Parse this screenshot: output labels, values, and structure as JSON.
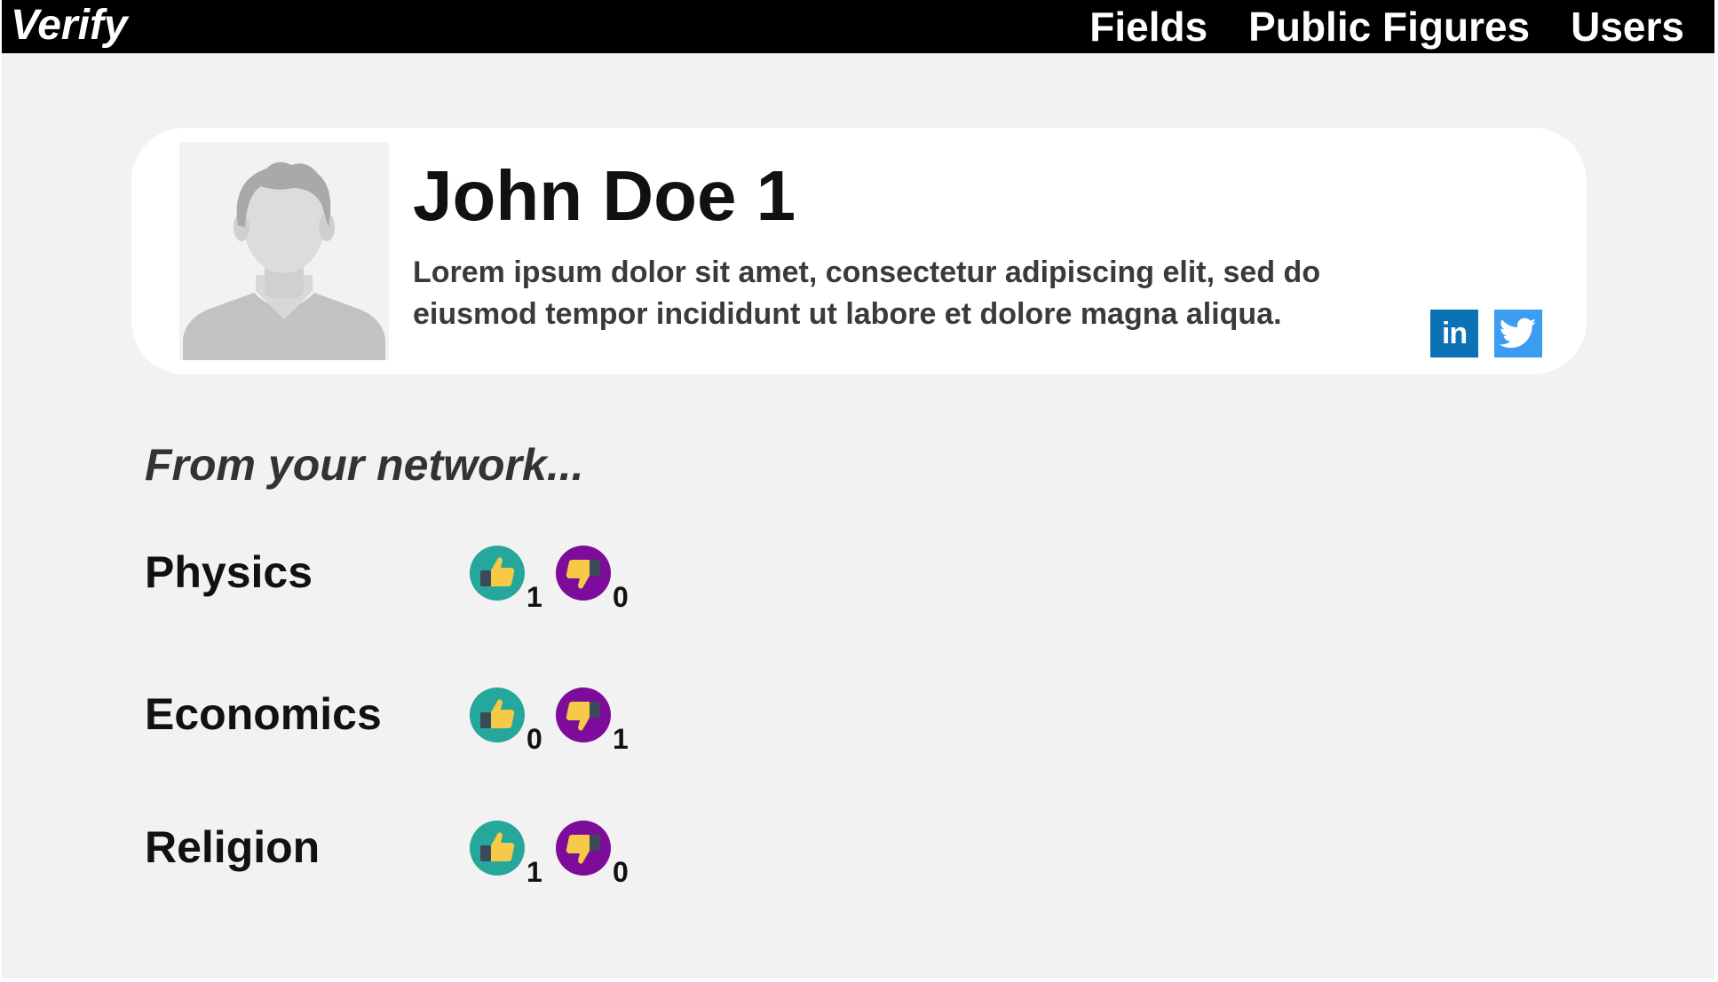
{
  "app": {
    "brand": "Verify",
    "nav": [
      "Fields",
      "Public Figures",
      "Users"
    ]
  },
  "profile": {
    "name": "John Doe 1",
    "bio": "Lorem ipsum dolor sit amet, consectetur adipiscing elit, sed do eiusmod tempor incididunt ut labore et dolore magna aliqua.",
    "social": [
      {
        "icon": "linkedin-icon",
        "label": "in",
        "color": "#0c72b5"
      },
      {
        "icon": "twitter-icon",
        "label": "",
        "color": "#3c9df0"
      }
    ]
  },
  "network": {
    "heading": "From your network...",
    "fields": [
      {
        "name": "Physics",
        "upvotes": "1",
        "downvotes": "0"
      },
      {
        "name": "Economics",
        "upvotes": "0",
        "downvotes": "1"
      },
      {
        "name": "Religion",
        "upvotes": "1",
        "downvotes": "0"
      }
    ]
  },
  "colors": {
    "topbar": "#000000",
    "background": "#f2f2f2",
    "upvote_circle": "#26a79b",
    "downvote_circle": "#7c0c99",
    "thumb": "#f7c948",
    "cuff": "#3a4a59"
  }
}
